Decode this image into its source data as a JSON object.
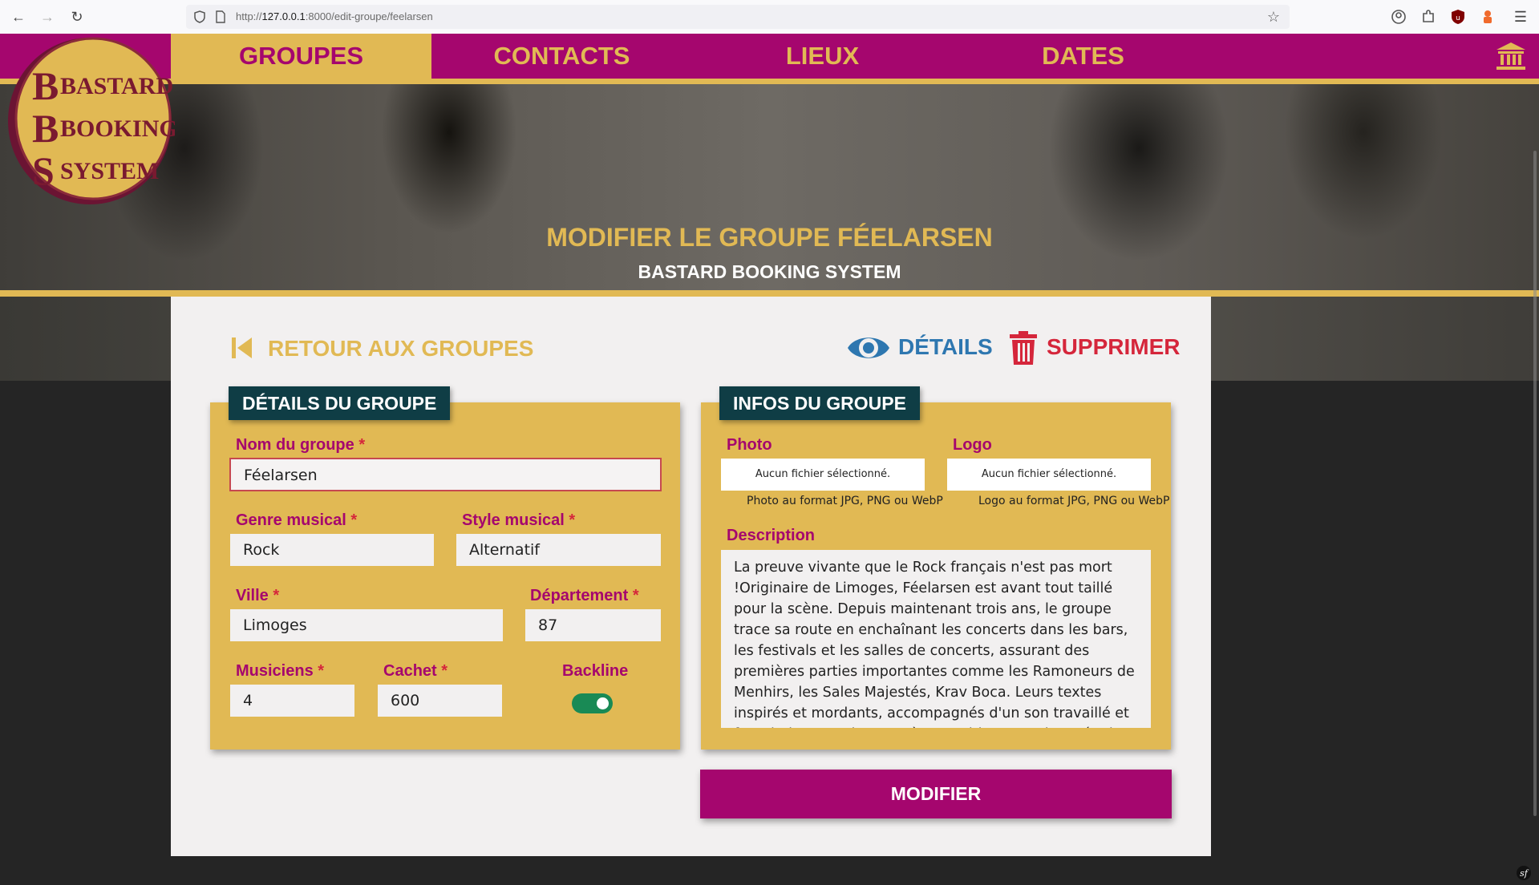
{
  "browser": {
    "url_prefix": "http://",
    "url_host": "127.0.0.1",
    "url_rest": ":8000/edit-groupe/feelarsen"
  },
  "nav": {
    "items": [
      {
        "label": "GROUPES",
        "active": true
      },
      {
        "label": "CONTACTS",
        "active": false
      },
      {
        "label": "LIEUX",
        "active": false
      },
      {
        "label": "DATES",
        "active": false
      }
    ]
  },
  "logo": {
    "line1": "BASTARD",
    "line2": "BOOKING",
    "line3": "SYSTEM"
  },
  "hero": {
    "title": "MODIFIER LE GROUPE FÉELARSEN",
    "subtitle": "BASTARD BOOKING SYSTEM"
  },
  "actions": {
    "back": "RETOUR AUX GROUPES",
    "details": "DÉTAILS",
    "delete": "SUPPRIMER"
  },
  "details_panel": {
    "title": "DÉTAILS DU GROUPE",
    "required_mark": "*",
    "nom": {
      "label": "Nom du groupe",
      "value": "Féelarsen"
    },
    "genre": {
      "label": "Genre musical",
      "value": "Rock"
    },
    "style": {
      "label": "Style musical",
      "value": "Alternatif"
    },
    "ville": {
      "label": "Ville",
      "value": "Limoges"
    },
    "departement": {
      "label": "Département",
      "value": "87"
    },
    "musiciens": {
      "label": "Musiciens",
      "value": "4"
    },
    "cachet": {
      "label": "Cachet",
      "value": "600"
    },
    "backline": {
      "label": "Backline",
      "checked": true
    }
  },
  "infos_panel": {
    "title": "INFOS DU GROUPE",
    "photo": {
      "label": "Photo",
      "button": "Aucun fichier sélectionné.",
      "hint": "Photo au format JPG, PNG ou WebP"
    },
    "logo": {
      "label": "Logo",
      "button": "Aucun fichier sélectionné.",
      "hint": "Logo au format JPG, PNG ou WebP"
    },
    "description": {
      "label": "Description",
      "value": "La preuve vivante que le Rock français n'est pas mort !Originaire de Limoges, Féelarsen est avant tout taillé pour la scène. Depuis maintenant trois ans, le groupe trace sa route en enchaînant les concerts dans les bars, les festivals et les salles de concerts, assurant des premières parties importantes comme les Ramoneurs de Menhirs, les Sales Majestés, Krav Boca. Leurs textes inspirés et mordants, accompagnés d'un son travaillé et fourni, donnent du corps à une critique assaisonnée de notre société. Des"
    }
  },
  "submit": {
    "label": "MODIFIER"
  },
  "colors": {
    "magenta": "#a5066e",
    "gold": "#e1b954",
    "teal": "#0f3d45",
    "blue": "#2e77b0",
    "red": "#d5263b",
    "green": "#198a55"
  }
}
